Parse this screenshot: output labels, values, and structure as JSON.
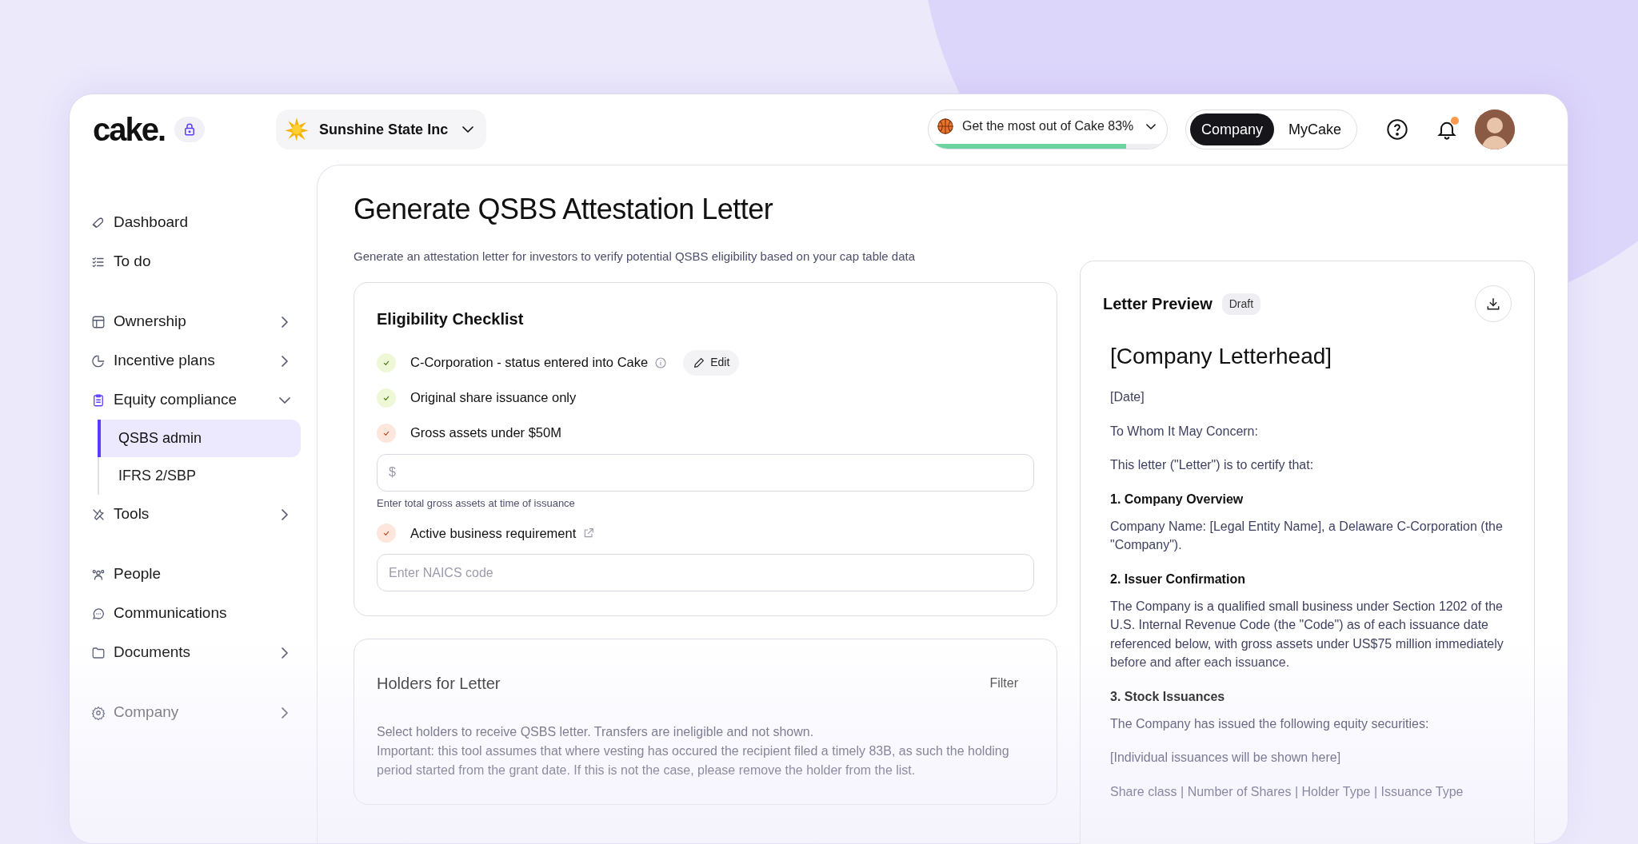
{
  "header": {
    "logo": "cake.",
    "company": "Sunshine State Inc",
    "progress": {
      "label": "Get the most out of Cake 83%",
      "level": 0.83
    },
    "toggle": [
      {
        "label": "Company",
        "selected": true
      },
      {
        "label": "MyCake",
        "selected": false
      }
    ],
    "notification_dot": true
  },
  "sidebar": {
    "groups": [
      [
        {
          "label": "Dashboard"
        },
        {
          "label": "To do"
        }
      ],
      [
        {
          "label": "Ownership",
          "expanded": false
        },
        {
          "label": "Incentive plans",
          "expanded": false
        },
        {
          "label": "Equity compliance",
          "expanded": true,
          "children": [
            {
              "label": "QSBS admin",
              "selected": true
            },
            {
              "label": "IFRS 2/SBP",
              "selected": false
            }
          ]
        },
        {
          "label": "Tools",
          "expanded": false
        }
      ],
      [
        {
          "label": "People"
        },
        {
          "label": "Communications"
        },
        {
          "label": "Documents",
          "expanded": false
        }
      ],
      [
        {
          "label": "Company",
          "expanded": false
        }
      ]
    ]
  },
  "page": {
    "title": "Generate QSBS Attestation Letter",
    "subtitle": "Generate an attestation letter for investors to verify potential QSBS eligibility based on your cap table data"
  },
  "checklist": {
    "title": "Eligibility Checklist",
    "items": [
      {
        "label": "C-Corporation - status entered into Cake",
        "kind": "complete",
        "button": "Edit"
      },
      {
        "label": "Original share issuance only",
        "kind": "complete"
      },
      {
        "label": "Gross assets under $50M",
        "kind": "pending",
        "field": {
          "placeholder": "$",
          "hint": "Enter total gross assets at time of issuance"
        }
      },
      {
        "label": "Active business requirement",
        "kind": "pending",
        "field": {
          "placeholder": "Enter NAICS code"
        }
      }
    ]
  },
  "holders": {
    "title": "Holders for Letter",
    "filter": "Filter",
    "lines": [
      "Select holders to receive QSBS letter. Transfers are ineligible and not shown.",
      "Important: this tool assumes that where vesting has occured the recipient filed a timely 83B, as such the holding period started from the grant date. If this is not the case, please remove the holder from the list."
    ]
  },
  "letter": {
    "title": "Letter Preview",
    "badge": "Draft",
    "blocks": [
      {
        "kind": "heading",
        "text": "[Company Letterhead]"
      },
      {
        "kind": "para",
        "text": "[Date]"
      },
      {
        "kind": "para",
        "text": "To Whom It May Concern:"
      },
      {
        "kind": "para",
        "text": "This letter (\"Letter\") is to certify that:"
      },
      {
        "kind": "section",
        "text": "1. Company Overview"
      },
      {
        "kind": "para",
        "text": "Company Name: [Legal Entity Name], a Delaware C-Corporation (the \"Company\")."
      },
      {
        "kind": "section",
        "text": "2. Issuer Confirmation"
      },
      {
        "kind": "para",
        "text": "The Company is a qualified small business under Section 1202 of the U.S. Internal Revenue Code (the \"Code\") as of each issuance date referenced below, with gross assets under US$75 million immediately before and after each issuance."
      },
      {
        "kind": "section",
        "text": "3. Stock Issuances"
      },
      {
        "kind": "para",
        "text": "The Company has issued the following equity securities:"
      },
      {
        "kind": "para",
        "text": "[Individual issuances will be shown here]"
      },
      {
        "kind": "para",
        "text": "Share class | Number of Shares | Holder Type | Issuance Type"
      }
    ]
  }
}
